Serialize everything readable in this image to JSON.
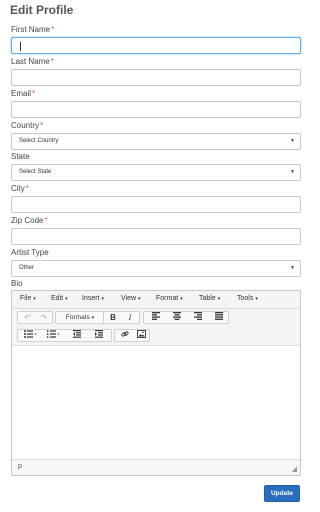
{
  "page": {
    "title": "Edit Profile"
  },
  "fields": {
    "first_name": {
      "label": "First Name",
      "required": "*",
      "value": ""
    },
    "last_name": {
      "label": "Last Name",
      "required": "*",
      "value": ""
    },
    "email": {
      "label": "Email",
      "required": "*",
      "value": ""
    },
    "country": {
      "label": "Country",
      "required": "*",
      "selected": "Select Country"
    },
    "state": {
      "label": "State",
      "selected": "Select State"
    },
    "city": {
      "label": "City",
      "required": "*",
      "value": ""
    },
    "zip": {
      "label": "Zip Code",
      "required": "*",
      "value": ""
    },
    "artist_type": {
      "label": "Artist Type",
      "selected": "Other"
    },
    "bio": {
      "label": "Bio"
    }
  },
  "editor": {
    "menus": [
      {
        "label": "File"
      },
      {
        "label": "Edit"
      },
      {
        "label": "Insert"
      },
      {
        "label": "View"
      },
      {
        "label": "Format"
      },
      {
        "label": "Table"
      },
      {
        "label": "Tools"
      }
    ],
    "toolbar": {
      "formats_label": "Formats",
      "bold_label": "B",
      "italic_label": "I"
    },
    "status_path": "p",
    "dropdown_glyph": "▾",
    "select_arrow": "▼"
  },
  "actions": {
    "update_label": "Update"
  },
  "colors": {
    "primary": "#2a6dbf",
    "required": "#d9534f",
    "focus": "#66afe9"
  }
}
